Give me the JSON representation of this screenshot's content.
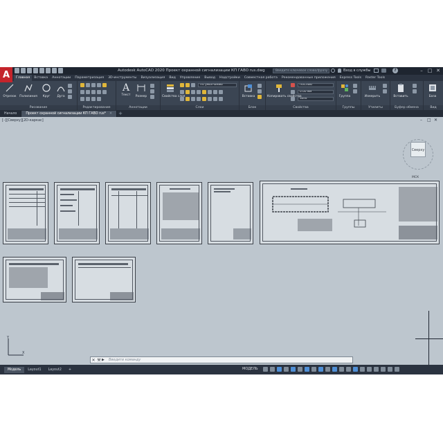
{
  "app": {
    "logo": "A",
    "window_title": "Autodesk AutoCAD 2020   Проект охранной сигнализации КП ГАВО rus.dwg",
    "search_placeholder": "Введите ключевое слово/фразу",
    "signin": "Вход в службы",
    "help": "?",
    "minimize": "–",
    "maximize": "□",
    "close": "✕"
  },
  "ribbon_tabs": [
    "Главная",
    "Вставка",
    "Аннотации",
    "Параметризация",
    "3D-инструменты",
    "Визуализация",
    "Вид",
    "Управление",
    "Вывод",
    "Надстройки",
    "Совместная работа",
    "Рекомендованные приложения",
    "Express Tools",
    "Raster Tools"
  ],
  "active_ribbon_tab": 0,
  "ribbon": {
    "draw_panel": "Рисование",
    "modify_panel": "Редактирование",
    "annotation_panel": "Аннотации",
    "layers_panel": "Слои",
    "block_panel": "Блок",
    "properties_panel": "Свойства",
    "groups_panel": "Группы",
    "utilities_panel": "Утилиты",
    "clipboard_panel": "Буфер обмена",
    "view_panel": "Вид",
    "tools": {
      "line": "Отрезок",
      "polyline": "Полилиния",
      "circle": "Круг",
      "arc": "Дуга",
      "text": "Текст",
      "dimension": "Размер",
      "layer_props": "Свойства слоя",
      "insert": "Вставка",
      "match_props": "Копировать свойства",
      "group": "Группа",
      "measure": "Измерить",
      "paste": "Вставить",
      "base": "База"
    },
    "layer_combo": "По умолчанию",
    "color_combo": "ПоСлою",
    "lineweight_combo": "0.00 мм",
    "linetype_combo": "Solid"
  },
  "file_tabs": [
    {
      "label": "Начало",
      "active": false
    },
    {
      "label": "Проект охранной сигнализации КП ГАВО rus*",
      "active": true
    }
  ],
  "viewport": {
    "label": "[–][Сверху][2D-каркас]",
    "viewcube_face": "Сверху",
    "wcs": "МСК"
  },
  "command_line": {
    "placeholder": "Введите команду"
  },
  "layout_tabs": [
    {
      "label": "Модель",
      "active": true
    },
    {
      "label": "Layout1",
      "active": false
    },
    {
      "label": "Layout2",
      "active": false
    }
  ],
  "status": {
    "model": "МОДЕЛЬ"
  }
}
